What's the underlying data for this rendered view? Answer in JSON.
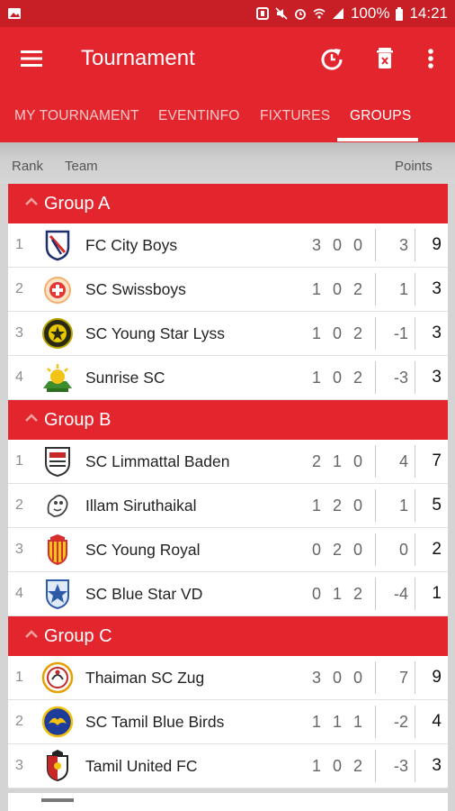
{
  "status_bar": {
    "battery": "100%",
    "time": "14:21"
  },
  "app_bar": {
    "title": "Tournament"
  },
  "tabs": [
    {
      "label": "MY TOURNAMENT",
      "active": false
    },
    {
      "label": "EVENTINFO",
      "active": false
    },
    {
      "label": "FIXTURES",
      "active": false
    },
    {
      "label": "GROUPS",
      "active": true
    }
  ],
  "columns": {
    "rank": "Rank",
    "team": "Team",
    "points": "Points"
  },
  "colors": {
    "primary": "#e3262e",
    "status": "#c81f26"
  },
  "groups": [
    {
      "title": "Group A",
      "teams": [
        {
          "rank": "1",
          "name": "FC City Boys",
          "record": "3 0 0",
          "diff": "3",
          "points": "9"
        },
        {
          "rank": "2",
          "name": "SC Swissboys",
          "record": "1 0 2",
          "diff": "1",
          "points": "3"
        },
        {
          "rank": "3",
          "name": "SC Young Star Lyss",
          "record": "1 0 2",
          "diff": "-1",
          "points": "3"
        },
        {
          "rank": "4",
          "name": "Sunrise SC",
          "record": "1 0 2",
          "diff": "-3",
          "points": "3"
        }
      ]
    },
    {
      "title": "Group B",
      "teams": [
        {
          "rank": "1",
          "name": "SC Limmattal Baden",
          "record": "2 1 0",
          "diff": "4",
          "points": "7"
        },
        {
          "rank": "2",
          "name": "Illam Siruthaikal",
          "record": "1 2 0",
          "diff": "1",
          "points": "5"
        },
        {
          "rank": "3",
          "name": "SC Young Royal",
          "record": "0 2 0",
          "diff": "0",
          "points": "2"
        },
        {
          "rank": "4",
          "name": "SC Blue Star VD",
          "record": "0 1 2",
          "diff": "-4",
          "points": "1"
        }
      ]
    },
    {
      "title": "Group C",
      "teams": [
        {
          "rank": "1",
          "name": "Thaiman SC Zug",
          "record": "3 0 0",
          "diff": "7",
          "points": "9"
        },
        {
          "rank": "2",
          "name": "SC Tamil Blue Birds",
          "record": "1 1 1",
          "diff": "-2",
          "points": "4"
        },
        {
          "rank": "3",
          "name": "Tamil United FC",
          "record": "1 0 2",
          "diff": "-3",
          "points": "3"
        }
      ]
    }
  ]
}
